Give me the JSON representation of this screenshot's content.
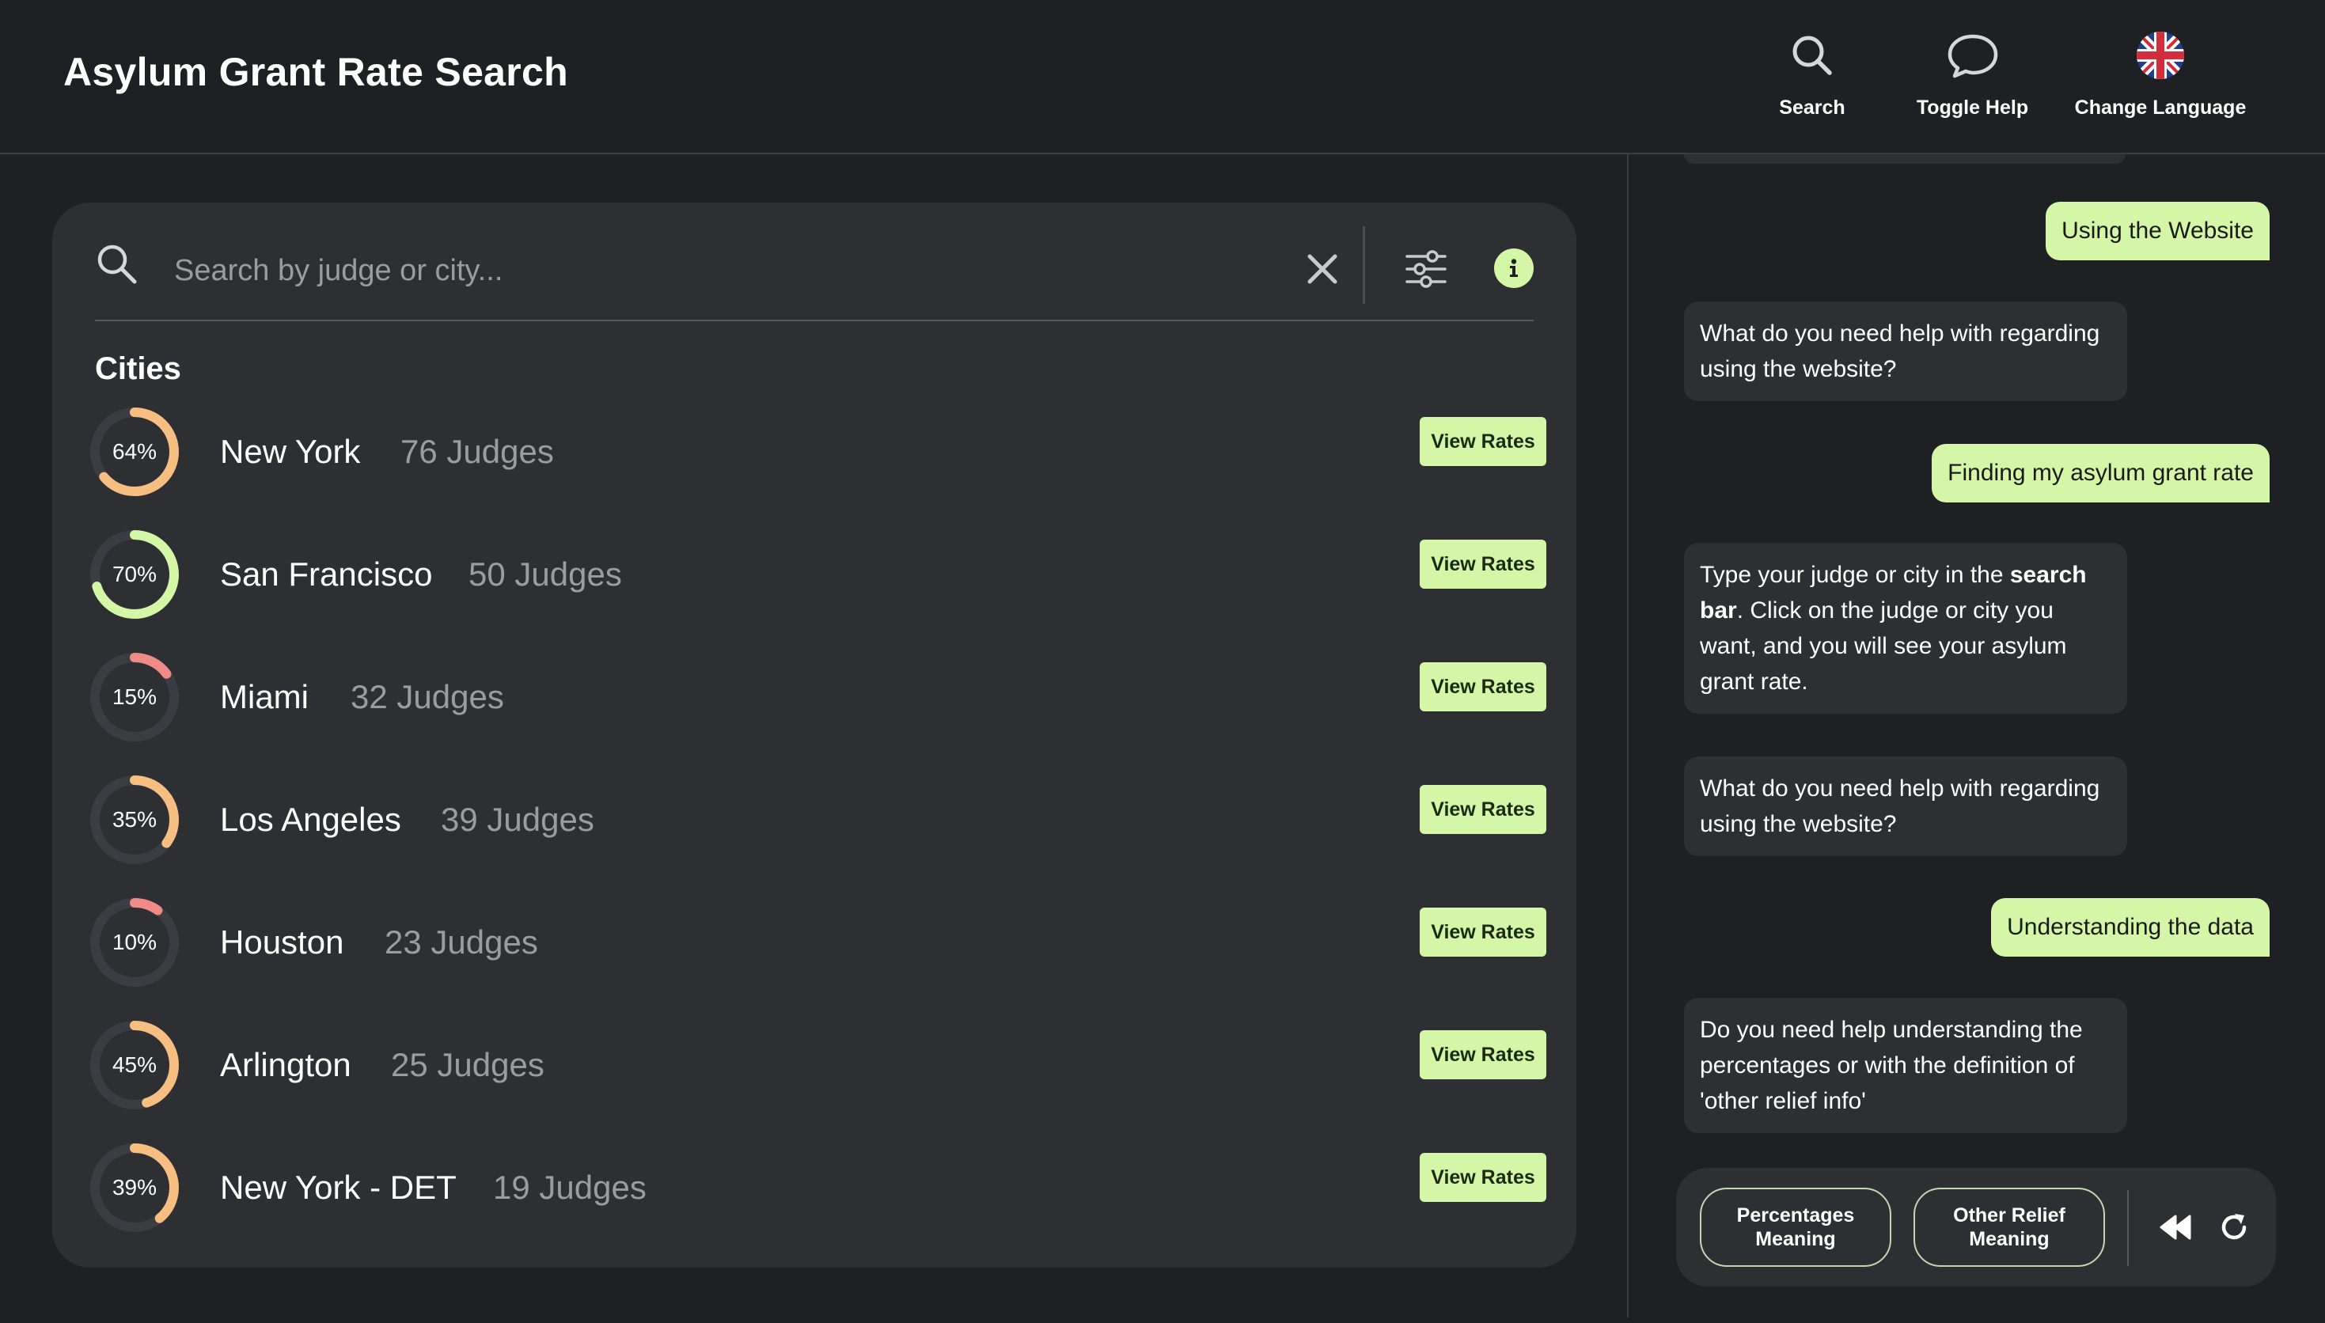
{
  "header": {
    "title": "Asylum Grant Rate Search",
    "nav": [
      {
        "label": "Search",
        "icon": "search-icon"
      },
      {
        "label": "Toggle Help",
        "icon": "chat-bubble-icon"
      },
      {
        "label": "Change Language",
        "icon": "uk-flag-icon"
      }
    ]
  },
  "search": {
    "placeholder": "Search by judge or city..."
  },
  "cities_section": {
    "title": "Cities",
    "button_label": "View Rates",
    "items": [
      {
        "name": "New York",
        "judges": "76 Judges",
        "rate_label": "64%",
        "rate": 64,
        "color": "#f7be82"
      },
      {
        "name": "San Francisco",
        "judges": "50 Judges",
        "rate_label": "70%",
        "rate": 70,
        "color": "#d3f7a6"
      },
      {
        "name": "Miami",
        "judges": "32 Judges",
        "rate_label": "15%",
        "rate": 15,
        "color": "#f08a86"
      },
      {
        "name": "Los Angeles",
        "judges": "39 Judges",
        "rate_label": "35%",
        "rate": 35,
        "color": "#f7be82"
      },
      {
        "name": "Houston",
        "judges": "23 Judges",
        "rate_label": "10%",
        "rate": 10,
        "color": "#f08a86"
      },
      {
        "name": "Arlington",
        "judges": "25 Judges",
        "rate_label": "45%",
        "rate": 45,
        "color": "#f7be82"
      },
      {
        "name": "New York - DET",
        "judges": "19 Judges",
        "rate_label": "39%",
        "rate": 39,
        "color": "#f7be82"
      }
    ]
  },
  "chat": {
    "messages": [
      {
        "from": "user",
        "text": "Using the Website"
      },
      {
        "from": "bot",
        "text": "What do you need help with regarding using the website?"
      },
      {
        "from": "user",
        "text": "Finding my asylum grant rate"
      },
      {
        "from": "bot",
        "text_before": "Type your judge or city in the ",
        "text_bold": "search bar",
        "text_after": ". Click on the judge or city you want, and you will see your asylum grant rate."
      },
      {
        "from": "bot",
        "text": "What do you need help with regarding using the website?"
      },
      {
        "from": "user",
        "text": "Understanding the data"
      },
      {
        "from": "bot",
        "text": "Do you need help understanding the percentages or with the definition of 'other relief info'"
      }
    ],
    "quick_replies": {
      "percentages": "Percentages Meaning",
      "other_relief": "Other Relief Meaning"
    }
  },
  "colors": {
    "accent": "#d3f7a6",
    "mid": "#f7be82",
    "low": "#f08a86",
    "background": "#1f2023",
    "panel": "#2e2f33"
  }
}
